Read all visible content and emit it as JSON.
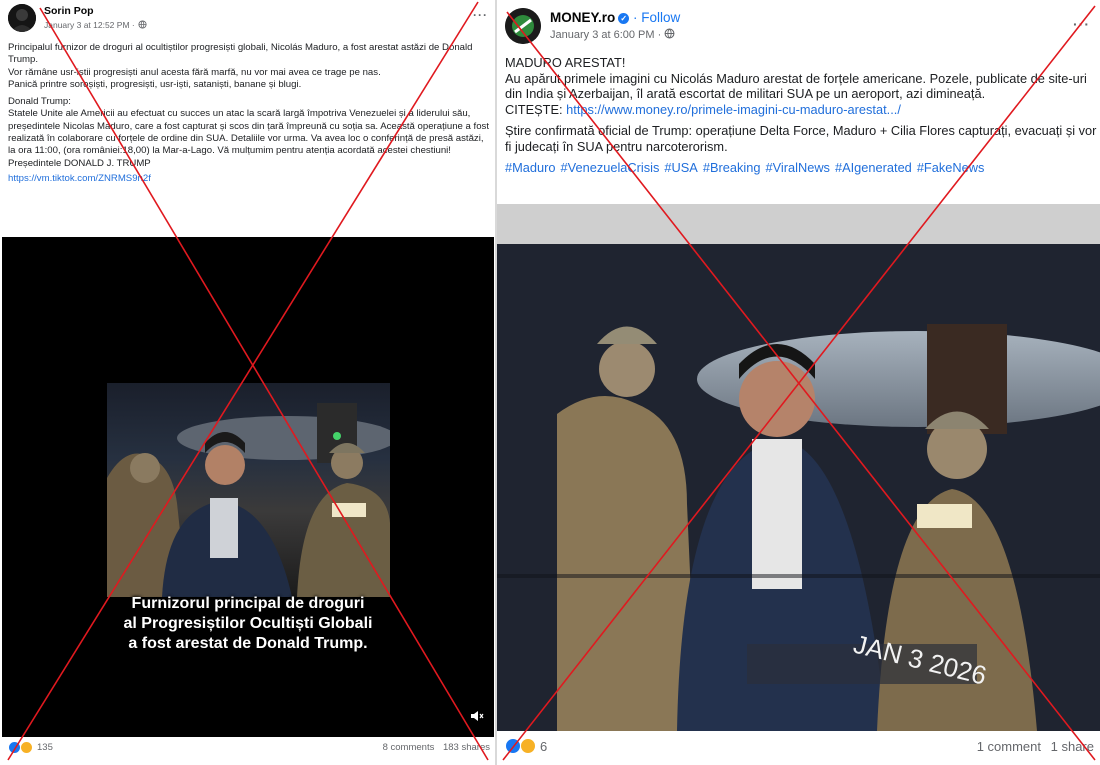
{
  "left_post": {
    "author": "Sorin Pop",
    "timestamp": "January 3 at 12:52 PM ·",
    "audience_icon": "globe-icon",
    "more_icon": "more-options-icon",
    "body": [
      "Principalul furnizor de droguri al ocultiștilor progresiști globali, Nicolás Maduro, a fost arestat astăzi de Donald Trump.",
      "Vor rămâne usr-iștii progresiști anul acesta fără marfă, nu vor mai avea ce trage pe nas.",
      "Panică printre soroșiști, progresiști, usr-iști, sataniști, banane și blugi."
    ],
    "quote": [
      "Donald Trump:",
      "Statele Unite ale Americii au efectuat cu succes un atac la scară largă împotriva Venezuelei și a liderului său, președintele Nicolas Maduro, care a fost capturat și scos din țară împreună cu soția sa. Această operațiune a fost realizată în colaborare cu forțele de ordine din SUA. Detaliile vor urma. Va avea loc o conferință de presă astăzi, la ora 11:00, (ora româniei:18,00) la Mar-a-Lago. Vă mulțumim pentru atenția acordată acestei chestiuni!",
      "Președintele DONALD J. TRUMP"
    ],
    "link": "https://vm.tiktok.com/ZNRMS9n2f",
    "video_caption": [
      "Furnizorul principal de droguri",
      "al Progresiștilor Ocultiști Globali",
      "a fost arestat de Donald Trump."
    ],
    "video_icon": "volume-mute-icon",
    "reaction_count": "135",
    "comments": "8 comments",
    "shares": "183 shares"
  },
  "right_post": {
    "author": "MONEY.ro",
    "follow": "· Follow",
    "timestamp": "January 3 at 6:00 PM ·",
    "audience_icon": "globe-icon",
    "more_icon": "more-options-icon",
    "headline": "MADURO ARESTAT!",
    "body": "Au apărut primele imagini cu Nicolás Maduro arestat de forțele americane. Pozele, publicate de site-uri din India și Azerbaijan, îl arată escortat de militari SUA pe un aeroport, azi dimineață.",
    "citeste_label": "CITEȘTE:",
    "citeste_link": "https://www.money.ro/primele-imagini-cu-maduro-arestat.../",
    "body2": "Știre confirmată oficial de Trump: operațiune Delta Force, Maduro + Cilia Flores capturați, evacuați și vor fi judecați în SUA pentru narcoterorism.",
    "hashtags": [
      "#Maduro",
      "#VenezuelaCrisis",
      "#USA",
      "#Breaking",
      "#ViralNews",
      "#AIgenerated",
      "#FakeNews"
    ],
    "image_stamp": "JAN 3 2026",
    "reaction_count": "6",
    "comments": "1 comment",
    "shares": "1 share"
  },
  "colors": {
    "link": "#216fdb",
    "facebook_blue": "#1877f2",
    "meta_gray": "#65676b",
    "cross_red": "#e0191f"
  }
}
